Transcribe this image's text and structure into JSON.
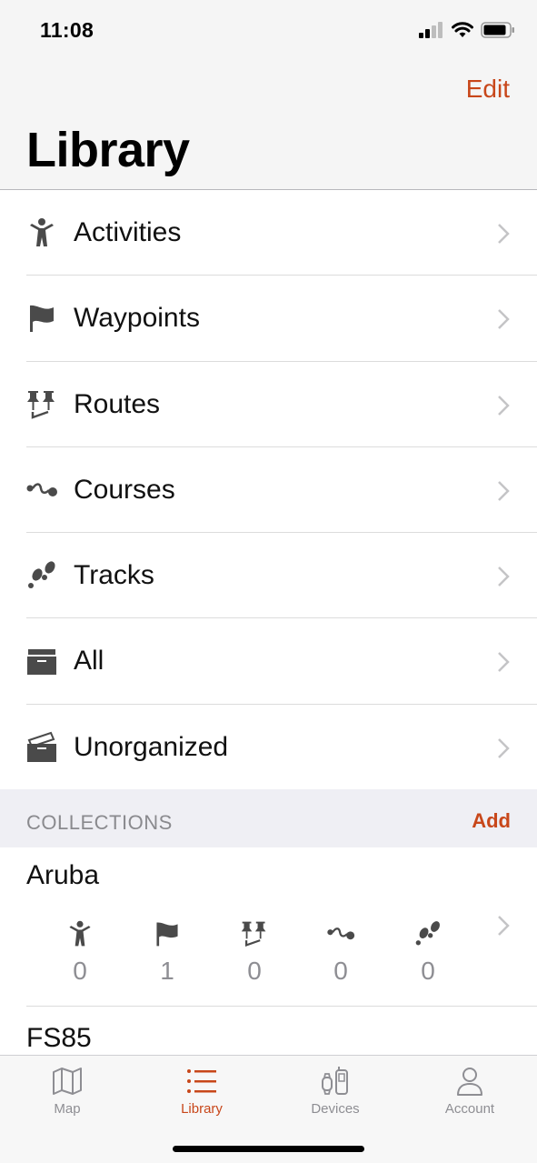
{
  "status_bar": {
    "time": "11:08"
  },
  "header": {
    "edit_label": "Edit",
    "title": "Library"
  },
  "menu": [
    {
      "label": "Activities",
      "icon": "person-icon"
    },
    {
      "label": "Waypoints",
      "icon": "flag-icon"
    },
    {
      "label": "Routes",
      "icon": "pushpins-icon"
    },
    {
      "label": "Courses",
      "icon": "course-icon"
    },
    {
      "label": "Tracks",
      "icon": "footprints-icon"
    },
    {
      "label": "All",
      "icon": "archive-box-icon"
    },
    {
      "label": "Unorganized",
      "icon": "open-box-icon"
    }
  ],
  "collections_section": {
    "title": "COLLECTIONS",
    "add_label": "Add"
  },
  "collections": [
    {
      "name": "Aruba",
      "counts": {
        "activities": "0",
        "waypoints": "1",
        "routes": "0",
        "courses": "0",
        "tracks": "0"
      }
    },
    {
      "name": "FS85"
    }
  ],
  "tab_bar": {
    "tabs": [
      {
        "label": "Map",
        "icon": "map-icon"
      },
      {
        "label": "Library",
        "icon": "list-icon",
        "active": true
      },
      {
        "label": "Devices",
        "icon": "devices-icon"
      },
      {
        "label": "Account",
        "icon": "person-outline-icon"
      }
    ]
  },
  "colors": {
    "accent": "#c8471a",
    "icon_gray": "#4a4a4a",
    "muted_gray": "#8e8e93"
  }
}
